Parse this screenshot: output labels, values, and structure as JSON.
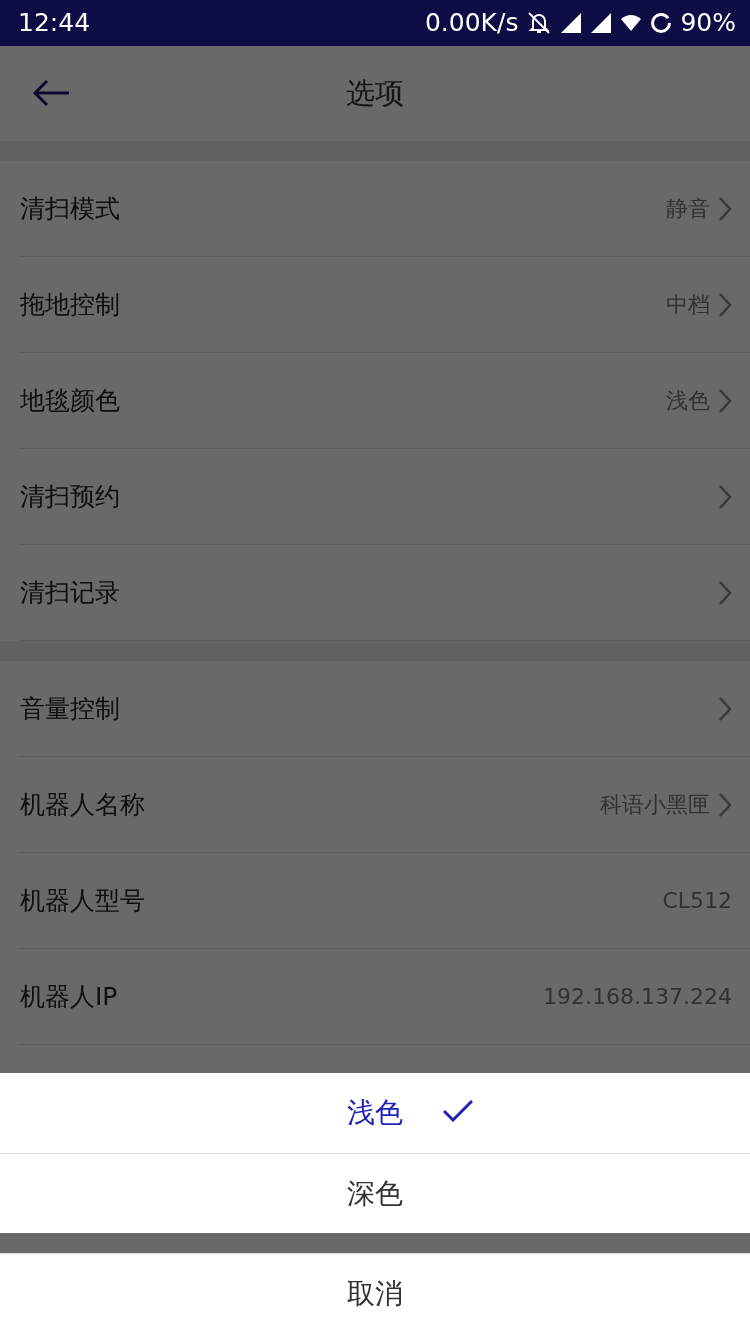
{
  "status_bar": {
    "time": "12:44",
    "speed": "0.00K/s",
    "battery": "90%"
  },
  "header": {
    "title": "选项"
  },
  "sections": [
    {
      "rows": [
        {
          "label": "清扫模式",
          "value": "静音",
          "chevron": true
        },
        {
          "label": "拖地控制",
          "value": "中档",
          "chevron": true
        },
        {
          "label": "地毯颜色",
          "value": "浅色",
          "chevron": true
        },
        {
          "label": "清扫预约",
          "chevron": true
        },
        {
          "label": "清扫记录",
          "chevron": true
        }
      ]
    },
    {
      "rows": [
        {
          "label": "音量控制",
          "chevron": true
        },
        {
          "label": "机器人名称",
          "value": "科语小黑匣",
          "chevron": true
        },
        {
          "label": "机器人型号",
          "value": "CL512",
          "chevron": false
        },
        {
          "label": "机器人IP",
          "value": "192.168.137.224",
          "chevron": false
        }
      ]
    }
  ],
  "sheet": {
    "options": [
      {
        "label": "浅色",
        "selected": true
      },
      {
        "label": "深色",
        "selected": false
      }
    ],
    "cancel": "取消"
  }
}
